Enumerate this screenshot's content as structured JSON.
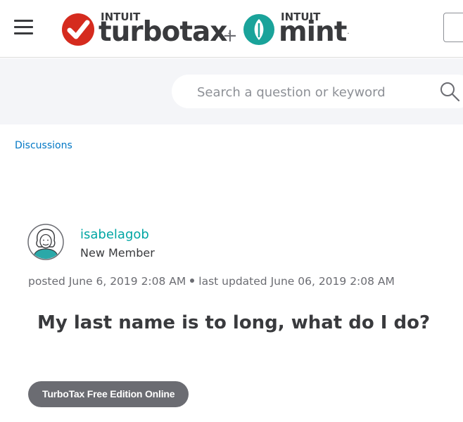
{
  "header": {
    "menu_icon": "hamburger-menu-icon",
    "turbotax_logo": {
      "intuit": "INTUIT",
      "name": "turbotax",
      "icon": "checkmark-icon",
      "color": "#d52b1e"
    },
    "plus": "+",
    "mint_logo": {
      "intuit": "INTUIT",
      "name": "mint",
      "icon": "mint-leaf-icon",
      "color": "#1aa39a"
    },
    "reg_mark": "."
  },
  "search": {
    "placeholder": "Search a question or keyword",
    "value": "",
    "icon": "search-icon"
  },
  "breadcrumb": {
    "label": "Discussions"
  },
  "post": {
    "author": {
      "username": "isabelagob",
      "rank": "New Member",
      "avatar_icon": "user-avatar-icon"
    },
    "posted_label": "posted",
    "posted_date": "June 6, 2019 2:08 AM",
    "updated_label": "last updated",
    "updated_date": "June 06, 2019 2:08 AM",
    "title": "My last name is to long, what do I do?",
    "tag": "TurboTax Free Edition Online"
  },
  "colors": {
    "link": "#0077c5",
    "username": "#00a6a4",
    "text": "#393a3d",
    "tag_bg": "#6b6c72",
    "band": "#f4f5f8"
  }
}
